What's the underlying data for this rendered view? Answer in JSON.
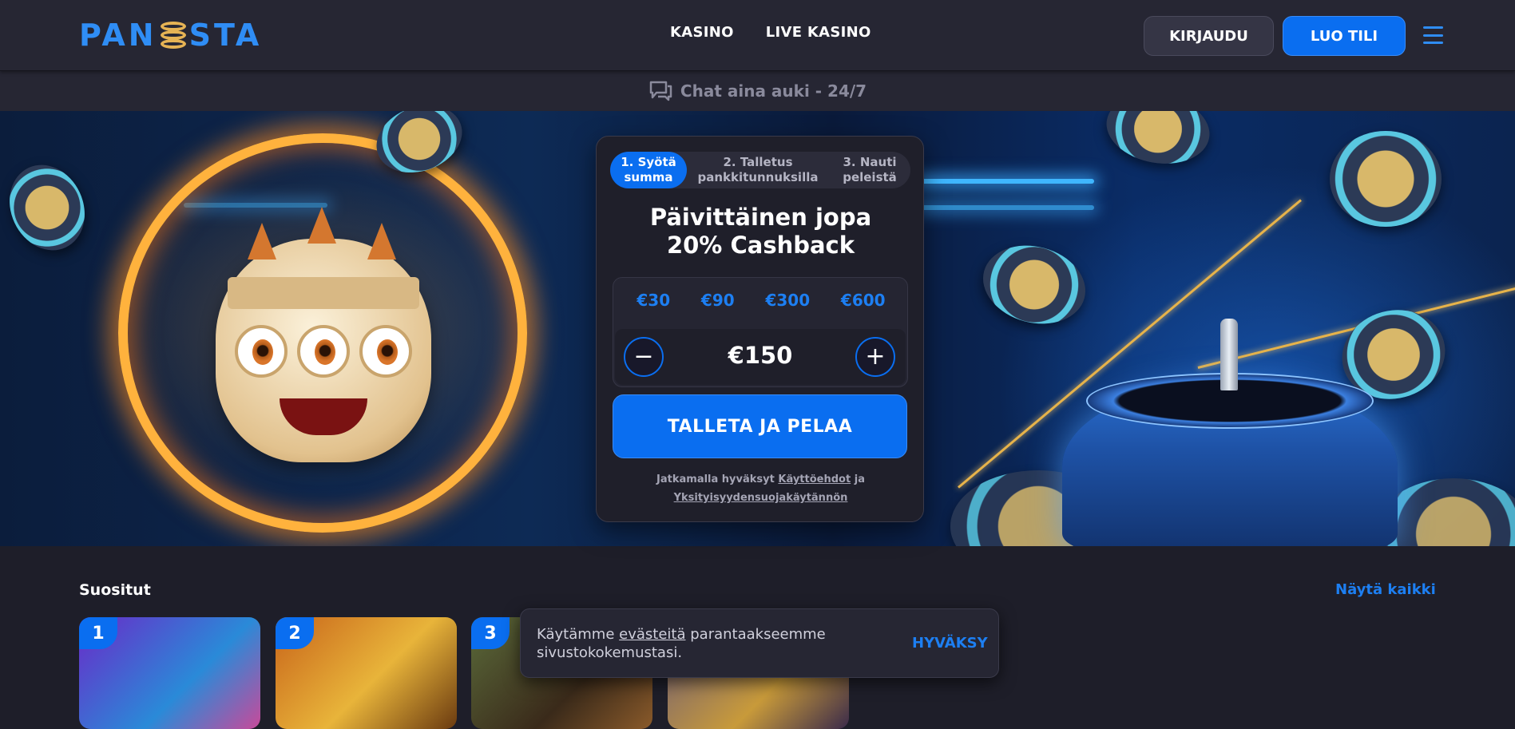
{
  "header": {
    "logo_text": "PANOSTA",
    "nav": [
      "KASINO",
      "LIVE KASINO"
    ],
    "login_label": "KIRJAUDU",
    "signup_label": "LUO TILI"
  },
  "chat": {
    "label": "Chat aina auki - 24/7"
  },
  "deposit": {
    "steps": [
      {
        "line1": "1. Syötä",
        "line2": "summa"
      },
      {
        "line1": "2. Talletus",
        "line2": "pankkitunnuksilla"
      },
      {
        "line1": "3. Nauti",
        "line2": "peleistä"
      }
    ],
    "title_line1": "Päivittäinen jopa",
    "title_line2": "20% Cashback",
    "presets": [
      "€30",
      "€90",
      "€300",
      "€600"
    ],
    "amount": "€150",
    "minus": "−",
    "plus": "+",
    "cta_label": "TALLETA JA PELAA",
    "terms_prefix": "Jatkamalla hyväksyt",
    "terms_link": "Käyttöehdot",
    "terms_and": "ja",
    "privacy_link": "Yksityisyydensuojakäytännön"
  },
  "popular": {
    "title": "Suositut",
    "show_all": "Näytä kaikki",
    "tiles": [
      {
        "rank": "1",
        "bg": "#3a2a8a"
      },
      {
        "rank": "2",
        "bg": "#8a4a10"
      },
      {
        "rank": "3",
        "bg": "#3a4a2a"
      },
      {
        "rank": "",
        "bg": "#4a3a5a"
      }
    ]
  },
  "cookie": {
    "prefix": "Käytämme",
    "link": "evästeitä",
    "suffix": "parantaakseemme sivustokokemustasi.",
    "accept": "HYVÄKSY"
  },
  "colors": {
    "accent": "#0a6ef0",
    "link": "#1d7ff2",
    "bg": "#1e1e29"
  }
}
